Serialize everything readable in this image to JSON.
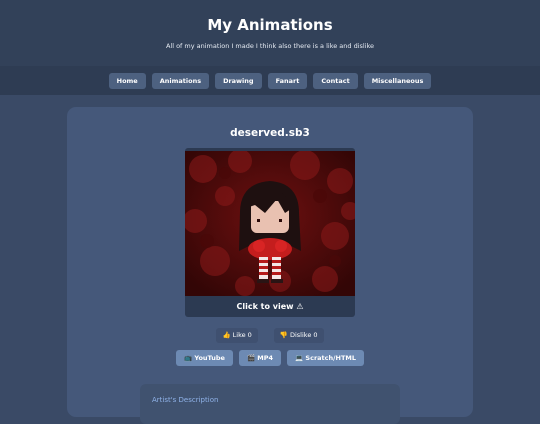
{
  "header": {
    "title": "My Animations",
    "subtitle": "All of my animation I made I think also there is a like and dislike"
  },
  "nav": {
    "items": [
      "Home",
      "Animations",
      "Drawing",
      "Fanart",
      "Contact",
      "Miscellaneous"
    ]
  },
  "project": {
    "title": "deserved.sb3",
    "thumbnail_cta": "Click to view ⚠",
    "votes": {
      "like_label": "👍 Like 0",
      "dislike_label": "👎 Dislike 0"
    },
    "links": {
      "youtube": "📺 YouTube",
      "mp4": "🎬 MP4",
      "scratch": "💻 Scratch/HTML"
    },
    "description_heading": "Artist's Description"
  },
  "colors": {
    "page_bg": "#3a4a66",
    "header_bg": "#324159",
    "nav_bg": "#2e3c53",
    "card_bg": "#45587a",
    "link_button": "#6d8ab3",
    "description_heading": "#8fb2e8"
  }
}
